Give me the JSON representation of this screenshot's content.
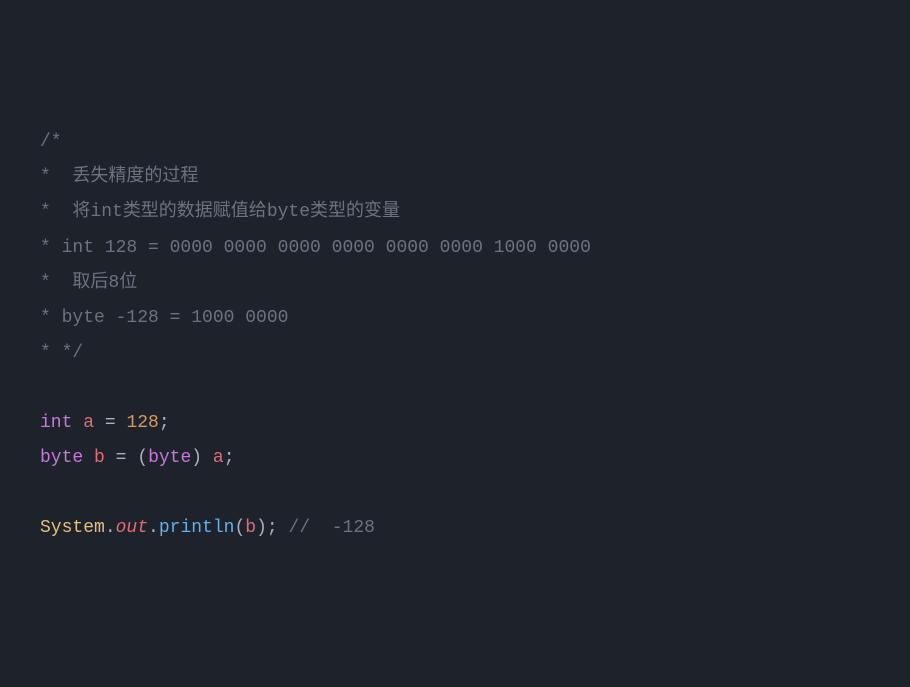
{
  "code": {
    "l1": "/*",
    "l2_star": "*  ",
    "l2_text": "丢失精度的过程",
    "l3_star": "*  ",
    "l3_t1": "将",
    "l3_kw1": "int",
    "l3_t2": "类型的数据赋值给",
    "l3_kw2": "byte",
    "l3_t3": "类型的变量",
    "l4": "* int 128 = 0000 0000 0000 0000 0000 0000 1000 0000",
    "l5_star": "*  ",
    "l5_text": "取后8位",
    "l6": "* byte -128 = 1000 0000",
    "l7": "* */",
    "l8": "",
    "l9_type": "int",
    "l9_sp1": " ",
    "l9_var": "a",
    "l9_eq": " = ",
    "l9_num": "128",
    "l9_semi": ";",
    "l10_type": "byte",
    "l10_sp1": " ",
    "l10_var": "b",
    "l10_eq": " = ",
    "l10_op": "(",
    "l10_cast": "byte",
    "l10_cp": ")",
    "l10_sp2": " ",
    "l10_rhs": "a",
    "l10_semi": ";",
    "l11": "",
    "l12_class": "System",
    "l12_d1": ".",
    "l12_field": "out",
    "l12_d2": ".",
    "l12_method": "println",
    "l12_op": "(",
    "l12_arg": "b",
    "l12_cp": ")",
    "l12_semi": ";",
    "l12_sp": " ",
    "l12_comment": "//  -128"
  }
}
